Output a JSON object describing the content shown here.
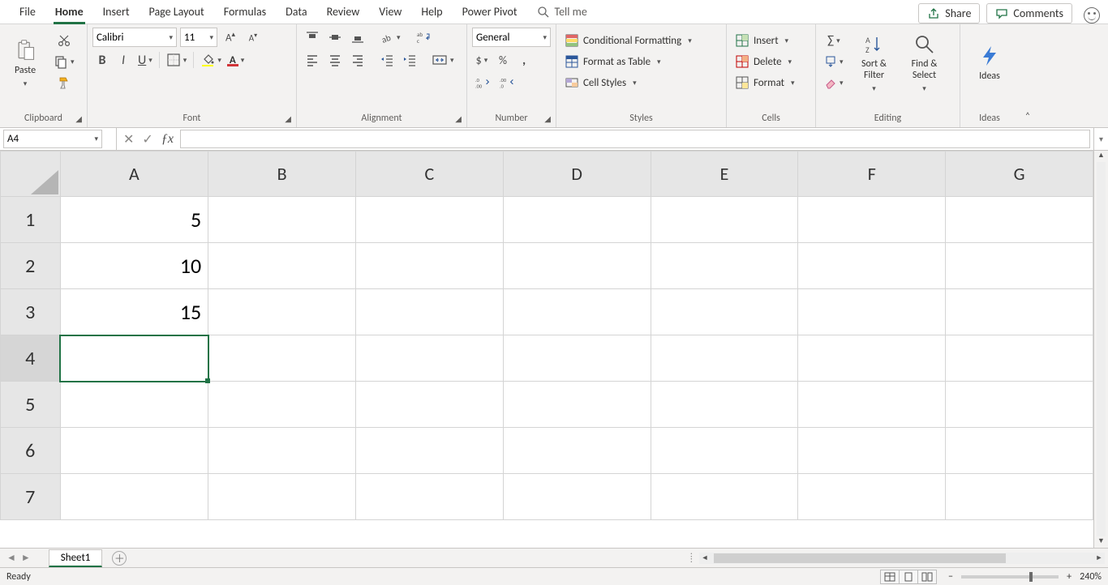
{
  "tabs": [
    "File",
    "Home",
    "Insert",
    "Page Layout",
    "Formulas",
    "Data",
    "Review",
    "View",
    "Help",
    "Power Pivot"
  ],
  "active_tab": "Home",
  "tellme": "Tell me",
  "share": "Share",
  "comments": "Comments",
  "ribbon": {
    "clipboard": {
      "paste": "Paste",
      "label": "Clipboard"
    },
    "font": {
      "name": "Calibri",
      "size": "11",
      "bold": "B",
      "italic": "I",
      "underline": "U",
      "label": "Font"
    },
    "alignment": {
      "label": "Alignment"
    },
    "number": {
      "format": "General",
      "label": "Number"
    },
    "styles": {
      "conditional": "Conditional Formatting",
      "table": "Format as Table",
      "cell": "Cell Styles",
      "label": "Styles"
    },
    "cells": {
      "insert": "Insert",
      "delete": "Delete",
      "format": "Format",
      "label": "Cells"
    },
    "editing": {
      "sortfilter": "Sort &\nFilter",
      "findselect": "Find &\nSelect",
      "label": "Editing"
    },
    "ideas": {
      "ideas": "Ideas",
      "label": "Ideas"
    }
  },
  "namebox": "A4",
  "formula": "",
  "columns": [
    "A",
    "B",
    "C",
    "D",
    "E",
    "F",
    "G"
  ],
  "rows": [
    "1",
    "2",
    "3",
    "4",
    "5",
    "6",
    "7"
  ],
  "cells": {
    "A1": "5",
    "A2": "10",
    "A3": "15"
  },
  "selected_cell": "A4",
  "sheet_tab": "Sheet1",
  "status": "Ready",
  "zoom": "240%"
}
